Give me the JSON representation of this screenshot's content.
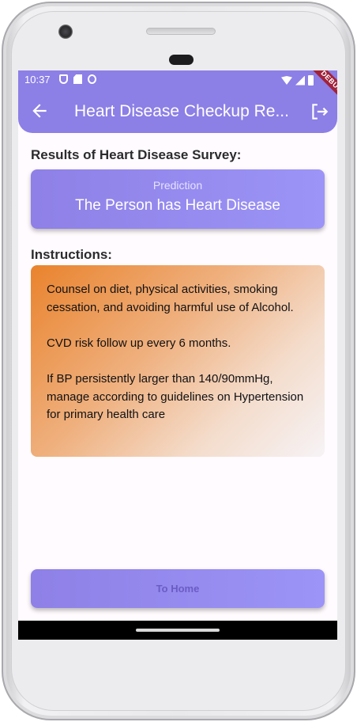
{
  "statusbar": {
    "time": "10:37",
    "icons": [
      "shield-icon",
      "sd-card-icon",
      "circle-icon",
      "wifi-icon",
      "signal-icon",
      "battery-icon"
    ]
  },
  "debug_banner": "DEBUG",
  "appbar": {
    "title": "Heart Disease Checkup Re...",
    "color": "#8c7fe6",
    "back_icon": "arrow-back-icon",
    "logout_icon": "logout-icon"
  },
  "results": {
    "heading": "Results of Heart Disease Survey:",
    "prediction_label": "Prediction",
    "prediction_value": "The Person has Heart Disease"
  },
  "instructions": {
    "heading": "Instructions:",
    "paragraphs": [
      "Counsel on diet, physical activities, smoking cessation, and avoiding harmful use of Alcohol.",
      "CVD risk follow up every 6 months.",
      "If BP persistently larger than 140/90mmHg, manage according to guidelines on Hypertension for primary health care"
    ]
  },
  "home_button": {
    "label": "To Home"
  },
  "colors": {
    "accent": "#8c7fe6",
    "instruction_gradient_start": "#e9832d",
    "debug": "#a1233b"
  }
}
